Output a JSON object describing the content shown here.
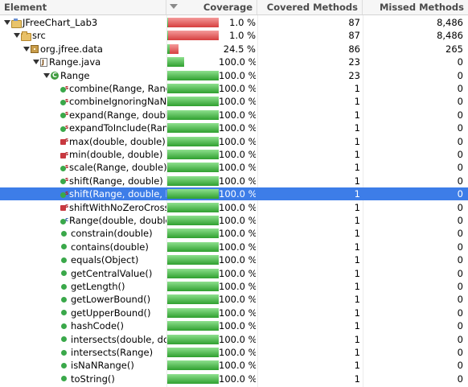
{
  "columns": {
    "element": "Element",
    "coverage": "Coverage",
    "covered_methods": "Covered Methods",
    "missed_methods": "Missed Methods"
  },
  "colors": {
    "covered": "#2fa02f",
    "missed": "#d63f3f",
    "selection": "#3d7de8"
  },
  "rows": [
    {
      "name": "JFreeChart_Lab3",
      "icon": "project-icon",
      "depth": 0,
      "twisty": true,
      "coverage": "1.0 %",
      "covered_fraction": 0.01,
      "covered": "87",
      "missed": "8,486"
    },
    {
      "name": "src",
      "icon": "source-folder-icon",
      "depth": 1,
      "twisty": true,
      "coverage": "1.0 %",
      "covered_fraction": 0.01,
      "covered": "87",
      "missed": "8,486"
    },
    {
      "name": "org.jfree.data",
      "icon": "package-icon",
      "depth": 2,
      "twisty": true,
      "coverage": "24.5 %",
      "covered_fraction": 0.245,
      "covered": "86",
      "missed": "265",
      "bar_fraction": 0.22
    },
    {
      "name": "Range.java",
      "icon": "java-file-icon",
      "depth": 3,
      "twisty": true,
      "coverage": "100.0 %",
      "covered_fraction": 1.0,
      "covered": "23",
      "missed": "0",
      "bar_fraction": 0.33
    },
    {
      "name": "Range",
      "icon": "class-icon",
      "depth": 4,
      "twisty": true,
      "coverage": "100.0 %",
      "covered_fraction": 1.0,
      "covered": "23",
      "missed": "0",
      "bar_fraction": 1.0
    },
    {
      "name": "combine(Range, Range)",
      "icon": "static-method-icon",
      "depth": 5,
      "coverage": "100.0 %",
      "covered_fraction": 1.0,
      "covered": "1",
      "missed": "0"
    },
    {
      "name": "combineIgnoringNaN(Range, Range)",
      "icon": "static-method-icon",
      "depth": 5,
      "coverage": "100.0 %",
      "covered_fraction": 1.0,
      "covered": "1",
      "missed": "0"
    },
    {
      "name": "expand(Range, double, double)",
      "icon": "static-method-icon",
      "depth": 5,
      "coverage": "100.0 %",
      "covered_fraction": 1.0,
      "covered": "1",
      "missed": "0"
    },
    {
      "name": "expandToInclude(Range, double)",
      "icon": "static-method-icon",
      "depth": 5,
      "coverage": "100.0 %",
      "covered_fraction": 1.0,
      "covered": "1",
      "missed": "0"
    },
    {
      "name": "max(double, double)",
      "icon": "private-static-method-icon",
      "depth": 5,
      "coverage": "100.0 %",
      "covered_fraction": 1.0,
      "covered": "1",
      "missed": "0"
    },
    {
      "name": "min(double, double)",
      "icon": "private-static-method-icon",
      "depth": 5,
      "coverage": "100.0 %",
      "covered_fraction": 1.0,
      "covered": "1",
      "missed": "0"
    },
    {
      "name": "scale(Range, double)",
      "icon": "static-method-icon",
      "depth": 5,
      "coverage": "100.0 %",
      "covered_fraction": 1.0,
      "covered": "1",
      "missed": "0"
    },
    {
      "name": "shift(Range, double)",
      "icon": "static-method-icon",
      "depth": 5,
      "coverage": "100.0 %",
      "covered_fraction": 1.0,
      "covered": "1",
      "missed": "0"
    },
    {
      "name": "shift(Range, double, boolean)",
      "icon": "static-method-icon",
      "depth": 5,
      "coverage": "100.0 %",
      "covered_fraction": 1.0,
      "covered": "1",
      "missed": "0",
      "selected": true
    },
    {
      "name": "shiftWithNoZeroCrossing(double, double)",
      "icon": "private-static-method-icon",
      "depth": 5,
      "coverage": "100.0 %",
      "covered_fraction": 1.0,
      "covered": "1",
      "missed": "0"
    },
    {
      "name": "Range(double, double)",
      "icon": "constructor-icon",
      "depth": 5,
      "coverage": "100.0 %",
      "covered_fraction": 1.0,
      "covered": "1",
      "missed": "0"
    },
    {
      "name": "constrain(double)",
      "icon": "method-icon",
      "depth": 5,
      "coverage": "100.0 %",
      "covered_fraction": 1.0,
      "covered": "1",
      "missed": "0"
    },
    {
      "name": "contains(double)",
      "icon": "method-icon",
      "depth": 5,
      "coverage": "100.0 %",
      "covered_fraction": 1.0,
      "covered": "1",
      "missed": "0"
    },
    {
      "name": "equals(Object)",
      "icon": "method-icon",
      "depth": 5,
      "coverage": "100.0 %",
      "covered_fraction": 1.0,
      "covered": "1",
      "missed": "0"
    },
    {
      "name": "getCentralValue()",
      "icon": "method-icon",
      "depth": 5,
      "coverage": "100.0 %",
      "covered_fraction": 1.0,
      "covered": "1",
      "missed": "0"
    },
    {
      "name": "getLength()",
      "icon": "method-icon",
      "depth": 5,
      "coverage": "100.0 %",
      "covered_fraction": 1.0,
      "covered": "1",
      "missed": "0"
    },
    {
      "name": "getLowerBound()",
      "icon": "method-icon",
      "depth": 5,
      "coverage": "100.0 %",
      "covered_fraction": 1.0,
      "covered": "1",
      "missed": "0"
    },
    {
      "name": "getUpperBound()",
      "icon": "method-icon",
      "depth": 5,
      "coverage": "100.0 %",
      "covered_fraction": 1.0,
      "covered": "1",
      "missed": "0"
    },
    {
      "name": "hashCode()",
      "icon": "method-icon",
      "depth": 5,
      "coverage": "100.0 %",
      "covered_fraction": 1.0,
      "covered": "1",
      "missed": "0"
    },
    {
      "name": "intersects(double, double)",
      "icon": "method-icon",
      "depth": 5,
      "coverage": "100.0 %",
      "covered_fraction": 1.0,
      "covered": "1",
      "missed": "0"
    },
    {
      "name": "intersects(Range)",
      "icon": "method-icon",
      "depth": 5,
      "coverage": "100.0 %",
      "covered_fraction": 1.0,
      "covered": "1",
      "missed": "0"
    },
    {
      "name": "isNaNRange()",
      "icon": "method-icon",
      "depth": 5,
      "coverage": "100.0 %",
      "covered_fraction": 1.0,
      "covered": "1",
      "missed": "0"
    },
    {
      "name": "toString()",
      "icon": "method-icon",
      "depth": 5,
      "coverage": "100.0 %",
      "covered_fraction": 1.0,
      "covered": "1",
      "missed": "0"
    }
  ]
}
